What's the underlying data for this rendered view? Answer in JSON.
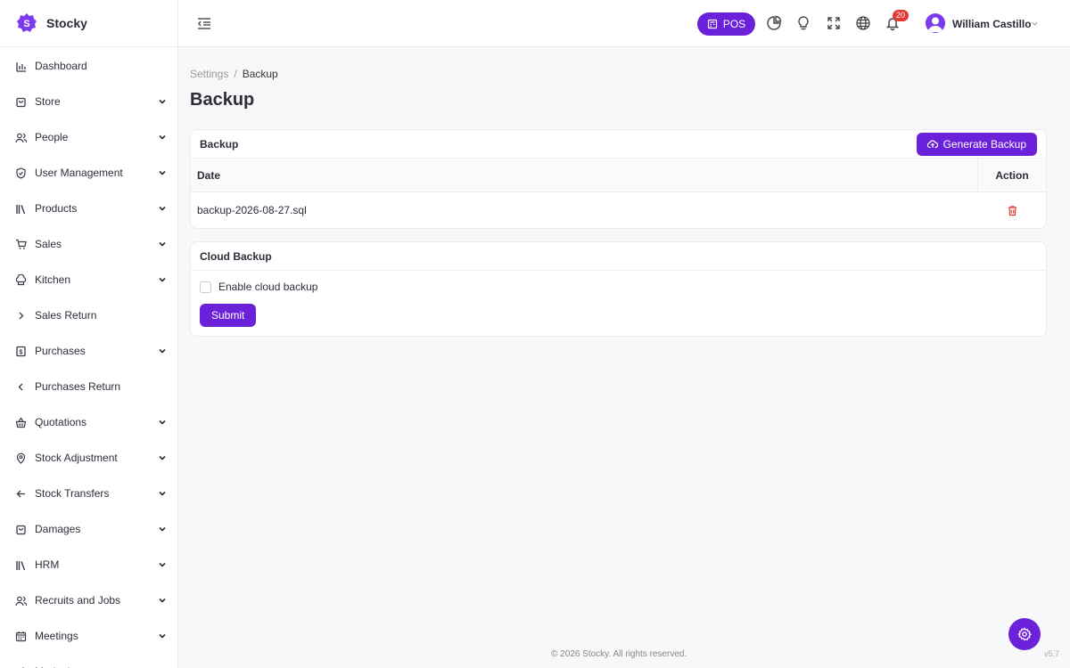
{
  "brand": {
    "name": "Stocky",
    "logo_letter": "S"
  },
  "sidebar": {
    "items": [
      {
        "label": "Dashboard",
        "icon": "bar-chart-icon",
        "chevron": "none"
      },
      {
        "label": "Store",
        "icon": "bag-icon",
        "chevron": "down"
      },
      {
        "label": "People",
        "icon": "users-icon",
        "chevron": "down"
      },
      {
        "label": "User Management",
        "icon": "shield-check-icon",
        "chevron": "down"
      },
      {
        "label": "Products",
        "icon": "library-icon",
        "chevron": "down"
      },
      {
        "label": "Sales",
        "icon": "cart-icon",
        "chevron": "down"
      },
      {
        "label": "Kitchen",
        "icon": "chef-hat-icon",
        "chevron": "down"
      },
      {
        "label": "Sales Return",
        "icon": "chevron-right-icon",
        "chevron": "none"
      },
      {
        "label": "Purchases",
        "icon": "dollar-receipt-icon",
        "chevron": "down"
      },
      {
        "label": "Purchases Return",
        "icon": "chevron-left-icon",
        "chevron": "none"
      },
      {
        "label": "Quotations",
        "icon": "basket-icon",
        "chevron": "down"
      },
      {
        "label": "Stock Adjustment",
        "icon": "map-pin-icon",
        "chevron": "down"
      },
      {
        "label": "Stock Transfers",
        "icon": "arrow-left-icon",
        "chevron": "down"
      },
      {
        "label": "Damages",
        "icon": "bag-icon",
        "chevron": "down"
      },
      {
        "label": "HRM",
        "icon": "library-icon",
        "chevron": "down"
      },
      {
        "label": "Recruits and Jobs",
        "icon": "users-icon",
        "chevron": "down"
      },
      {
        "label": "Meetings",
        "icon": "calendar-icon",
        "chevron": "down"
      },
      {
        "label": "Marketing",
        "icon": "megaphone-icon",
        "chevron": "down"
      }
    ]
  },
  "header": {
    "pos_label": "POS",
    "notification_count": "20",
    "user_name": "William Castillo"
  },
  "breadcrumb": {
    "parent": "Settings",
    "separator": "/",
    "current": "Backup"
  },
  "page_title": "Backup",
  "backup_card": {
    "title": "Backup",
    "generate_label": "Generate Backup",
    "columns": {
      "date": "Date",
      "action": "Action"
    },
    "rows": [
      {
        "date": "backup-2026-08-27.sql"
      }
    ]
  },
  "cloud_card": {
    "title": "Cloud Backup",
    "checkbox_label": "Enable cloud backup",
    "checkbox_checked": false,
    "submit_label": "Submit"
  },
  "footer": {
    "copyright": "© 2026 Stocky. All rights reserved.",
    "version": "v5.7"
  },
  "colors": {
    "accent": "#6b21d9",
    "danger": "#e53935"
  }
}
